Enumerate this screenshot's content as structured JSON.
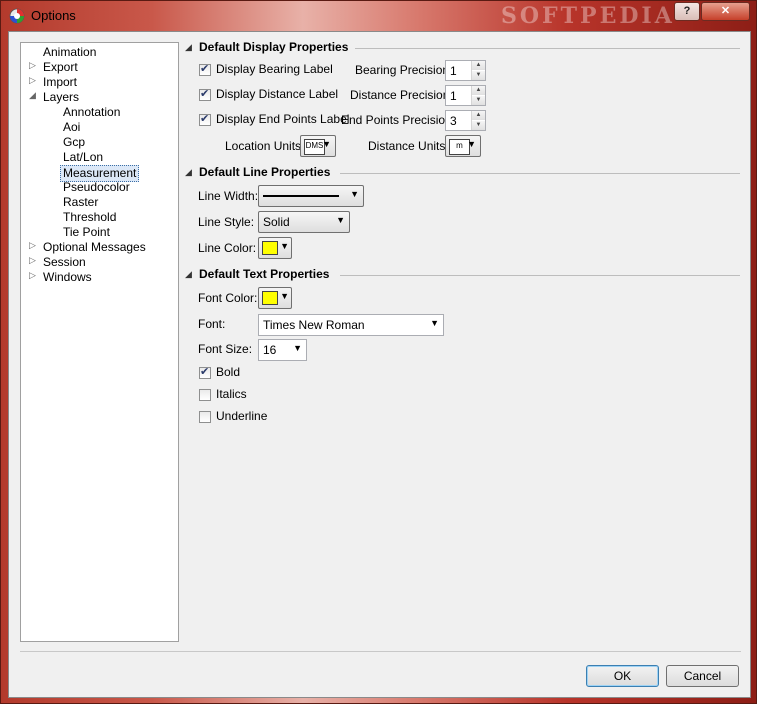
{
  "window": {
    "title": "Options",
    "watermark": "SOFTPEDIA",
    "help_glyph": "?",
    "close_glyph": "✕"
  },
  "tree": {
    "items": [
      {
        "label": "Animation",
        "expander": ""
      },
      {
        "label": "Export",
        "expander": "▷"
      },
      {
        "label": "Import",
        "expander": "▷"
      },
      {
        "label": "Layers",
        "expander": "◢"
      },
      {
        "label": "Annotation",
        "expander": ""
      },
      {
        "label": "Aoi",
        "expander": ""
      },
      {
        "label": "Gcp",
        "expander": ""
      },
      {
        "label": "Lat/Lon",
        "expander": ""
      },
      {
        "label": "Measurement",
        "expander": "",
        "selected": true
      },
      {
        "label": "Pseudocolor",
        "expander": ""
      },
      {
        "label": "Raster",
        "expander": ""
      },
      {
        "label": "Threshold",
        "expander": ""
      },
      {
        "label": "Tie Point",
        "expander": ""
      },
      {
        "label": "Optional Messages",
        "expander": "▷"
      },
      {
        "label": "Session",
        "expander": "▷"
      },
      {
        "label": "Windows",
        "expander": "▷"
      }
    ]
  },
  "display": {
    "section_title": "Default Display Properties",
    "collapse_glyph": "◢",
    "bearing_label": "Display Bearing Label",
    "bearing_checked": true,
    "distance_label": "Display Distance Label",
    "distance_checked": true,
    "endpoints_label": "Display End Points Label",
    "endpoints_checked": true,
    "bearing_precision_label": "Bearing Precision:",
    "bearing_precision_value": "1",
    "distance_precision_label": "Distance Precision:",
    "distance_precision_value": "1",
    "endpoints_precision_label": "End Points Precision:",
    "endpoints_precision_value": "3",
    "location_units_label": "Location Units:",
    "location_units_value": "DMS",
    "distance_units_label": "Distance Units:",
    "distance_units_value": "m"
  },
  "line": {
    "section_title": "Default Line Properties",
    "collapse_glyph": "◢",
    "width_label": "Line Width:",
    "style_label": "Line Style:",
    "style_value": "Solid",
    "color_label": "Line Color:",
    "color_hex": "#ffff00"
  },
  "text": {
    "section_title": "Default Text Properties",
    "collapse_glyph": "◢",
    "font_color_label": "Font Color:",
    "font_color_hex": "#ffff00",
    "font_label": "Font:",
    "font_value": "Times New Roman",
    "size_label": "Font Size:",
    "size_value": "16",
    "bold_label": "Bold",
    "bold_checked": true,
    "italics_label": "Italics",
    "italics_checked": false,
    "underline_label": "Underline",
    "underline_checked": false
  },
  "spin_up": "▲",
  "spin_down": "▼",
  "dropdown_glyph": "▼",
  "check_glyph": "✔",
  "buttons": {
    "ok": "OK",
    "cancel": "Cancel"
  }
}
